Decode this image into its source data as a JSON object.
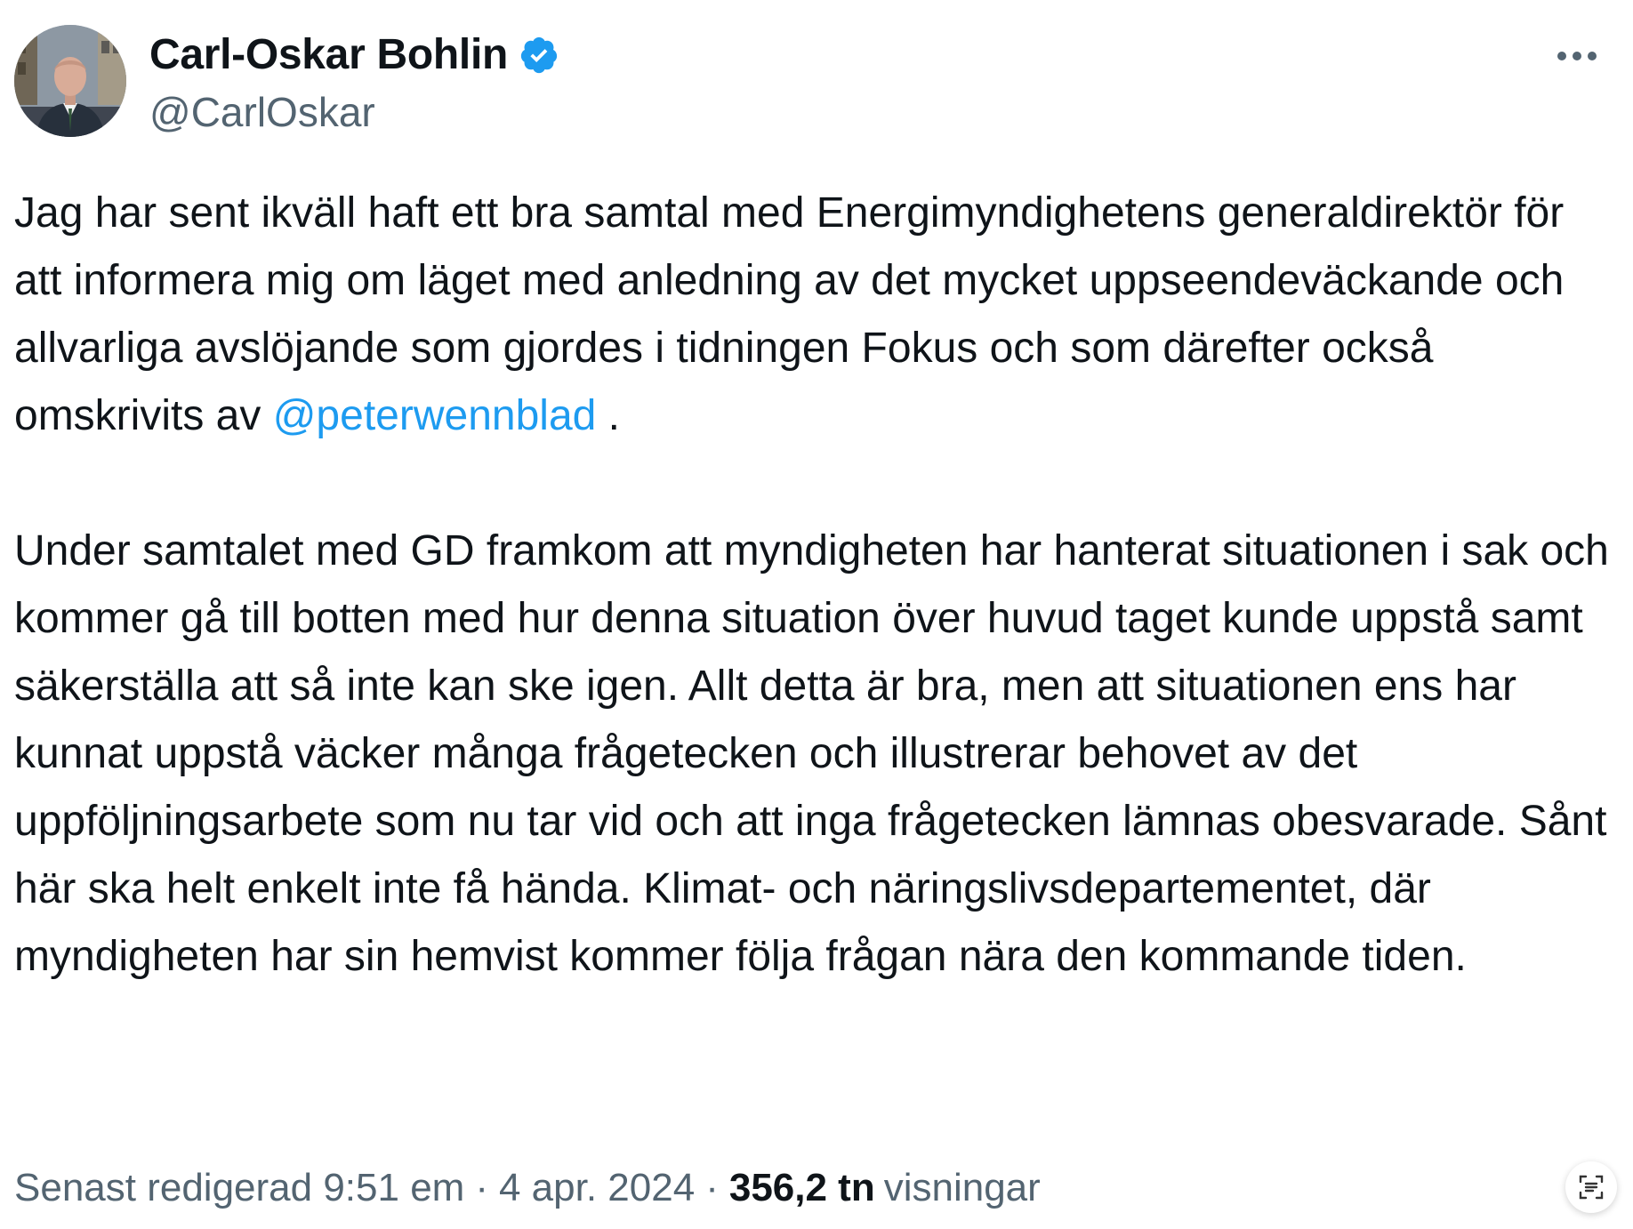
{
  "author": {
    "display_name": "Carl-Oskar Bohlin",
    "handle": "@CarlOskar",
    "verified": true
  },
  "tweet": {
    "para1_parts": [
      "Jag har sent ikväll haft ett bra samtal med Energimyndighetens generaldirektör för att informera mig om läget med anledning av det mycket uppseendeväckande och allvarliga avslöjande som gjordes i tidningen Fokus och som därefter också",
      "omskrivits av ",
      "@peterwennblad",
      " ."
    ],
    "para2": "Under samtalet med GD framkom att myndigheten har hanterat situationen i sak och kommer gå till botten med hur denna situation över huvud taget kunde uppstå samt säkerställa att så inte kan ske igen. Allt detta är bra, men att situationen ens har kunnat uppstå väcker många frågetecken och illustrerar behovet av det uppföljningsarbete som nu tar vid och att inga frågetecken lämnas obesvarade. Sånt här ska helt enkelt inte få hända. Klimat- och näringslivsdepartementet, där myndigheten har sin hemvist kommer följa frågan nära den kommande tiden."
  },
  "meta": {
    "edited_label": "Senast redigerad 9:51 em",
    "separator": "·",
    "date": "4 apr. 2024",
    "views_count": "356,2 tn",
    "views_label": "visningar"
  },
  "icons": {
    "verified": "verified-badge-icon",
    "more": "more-options-icon",
    "corner": "text-scan-icon"
  },
  "colors": {
    "link": "#1d9bf0",
    "text": "#0f1419",
    "muted": "#536471",
    "verified": "#1d9bf0"
  }
}
